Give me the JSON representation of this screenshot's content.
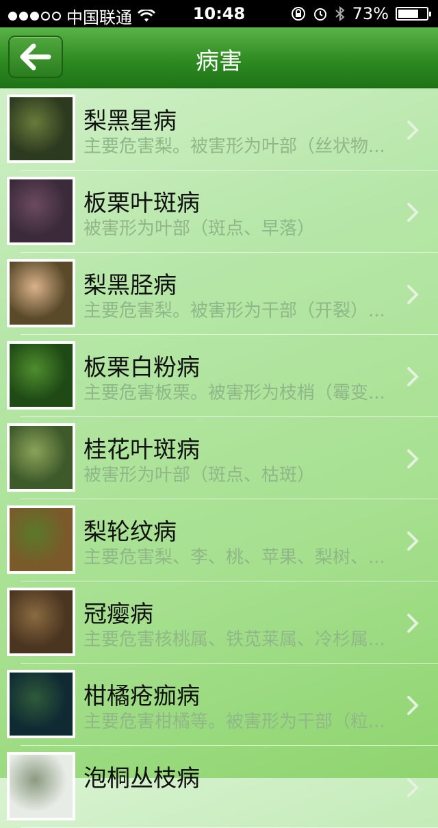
{
  "status_bar": {
    "carrier": "中国联通",
    "time": "10:48",
    "battery": "73%",
    "battery_level": 0.73
  },
  "navbar": {
    "title": "病害",
    "back_icon": "arrow-left-icon"
  },
  "items": [
    {
      "title": "梨黑星病",
      "subtitle": "主要危害梨。被害形为叶部（丝状物...",
      "thumb_colors": [
        "#2c3a1f",
        "#6a7b3a",
        "#e8e8e0"
      ]
    },
    {
      "title": "板栗叶斑病",
      "subtitle": "被害形为叶部（斑点、早落）",
      "thumb_colors": [
        "#3a2a3a",
        "#6b4a60",
        "#c77fb0"
      ]
    },
    {
      "title": "梨黑胫病",
      "subtitle": "主要危害梨。被害形为干部（开裂）...",
      "thumb_colors": [
        "#5a4a2a",
        "#d9b28a",
        "#f2f2ef"
      ]
    },
    {
      "title": "板栗白粉病",
      "subtitle": "主要危害板栗。被害形为枝梢（霉变...",
      "thumb_colors": [
        "#1f4a15",
        "#4e8d2e",
        "#9fd37a"
      ]
    },
    {
      "title": "桂花叶斑病",
      "subtitle": "被害形为叶部（斑点、枯斑）",
      "thumb_colors": [
        "#3f5a2a",
        "#8aa35a",
        "#dde6cc"
      ]
    },
    {
      "title": "梨轮纹病",
      "subtitle": "主要危害梨、李、桃、苹果、梨树、...",
      "thumb_colors": [
        "#7a5a2a",
        "#5a7a2a",
        "#f5f2e8"
      ]
    },
    {
      "title": "冠瘿病",
      "subtitle": "主要危害核桃属、铁苋莱属、冷杉属...",
      "thumb_colors": [
        "#4a3520",
        "#8a6a40",
        "#c8a878"
      ]
    },
    {
      "title": "柑橘疮痂病",
      "subtitle": "主要危害柑橘等。被害形为干部（粒...",
      "thumb_colors": [
        "#0f2a33",
        "#2f5a3a",
        "#8fb0a0"
      ]
    },
    {
      "title": "泡桐丛枝病",
      "subtitle": "",
      "thumb_colors": [
        "#e8ece6",
        "#8a9a80",
        "#ffffff"
      ]
    }
  ]
}
